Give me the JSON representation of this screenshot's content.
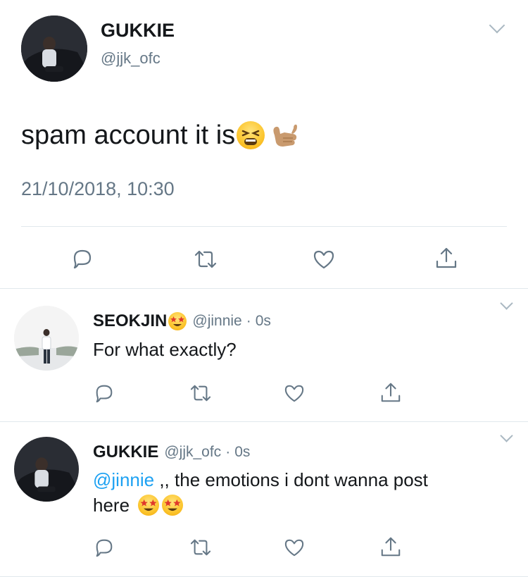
{
  "main_tweet": {
    "display_name": "GUKKIE",
    "handle": "@jjk_ofc",
    "text": "spam account it is",
    "timestamp": "21/10/2018, 10:30",
    "icons": {
      "reply": "reply-icon",
      "retweet": "retweet-icon",
      "like": "heart-icon",
      "share": "share-icon"
    }
  },
  "replies": [
    {
      "display_name": "SEOKJIN",
      "handle": "@jinnie",
      "separator": "·",
      "time": "0s",
      "text": "For what exactly?"
    },
    {
      "display_name": "GUKKIE",
      "handle": "@jjk_ofc",
      "separator": "·",
      "time": "0s",
      "mention": "@jinnie",
      "text_part1": " ,, the emotions i dont wanna post",
      "text_part2": "here"
    }
  ],
  "colors": {
    "accent": "#1da1f2",
    "muted": "#657786",
    "icon": "#657786",
    "divider": "#e1e8ed"
  }
}
